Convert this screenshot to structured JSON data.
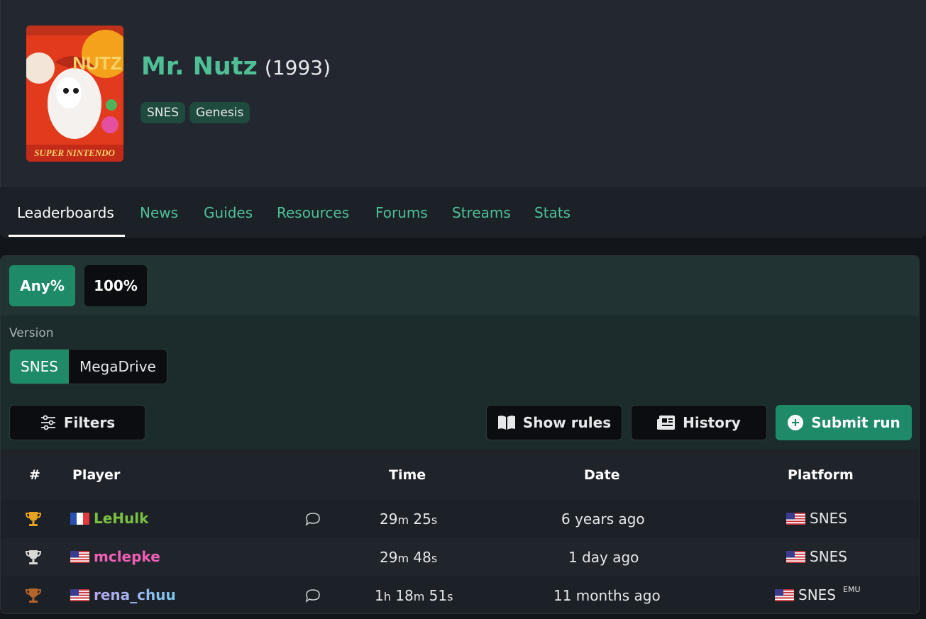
{
  "game": {
    "title": "Mr. Nutz",
    "year": "(1993)",
    "platforms": [
      "SNES",
      "Genesis"
    ]
  },
  "nav": {
    "tabs": [
      "Leaderboards",
      "News",
      "Guides",
      "Resources",
      "Forums",
      "Streams",
      "Stats"
    ],
    "active": "Leaderboards"
  },
  "categories": {
    "items": [
      "Any%",
      "100%"
    ],
    "selected": "Any%"
  },
  "version": {
    "label": "Version",
    "options": [
      "SNES",
      "MegaDrive"
    ],
    "selected": "SNES"
  },
  "actions": {
    "filters": "Filters",
    "show_rules": "Show rules",
    "history": "History",
    "submit": "Submit run"
  },
  "table": {
    "headers": {
      "rank": "#",
      "player": "Player",
      "time": "Time",
      "date": "Date",
      "platform": "Platform"
    },
    "rows": [
      {
        "rank_icon": "gold-trophy-icon",
        "flag": "france-flag-icon",
        "player": "LeHulk",
        "player_color": "#7bc043",
        "has_comment": true,
        "time": {
          "h": "",
          "m": "29",
          "s": "25"
        },
        "date": "6 years ago",
        "platform_flag": "usa-flag-icon",
        "platform": "SNES",
        "emu": ""
      },
      {
        "rank_icon": "silver-trophy-icon",
        "flag": "usa-flag-icon",
        "player": "mclepke",
        "player_color": "#ee5fb5",
        "has_comment": false,
        "time": {
          "h": "",
          "m": "29",
          "s": "48"
        },
        "date": "1 day ago",
        "platform_flag": "usa-flag-icon",
        "platform": "SNES",
        "emu": ""
      },
      {
        "rank_icon": "bronze-trophy-icon",
        "flag": "usa-flag-icon",
        "player": "rena_chuu",
        "player_color": "#8fb8e8",
        "has_comment": true,
        "time": {
          "h": "1",
          "m": "18",
          "s": "51"
        },
        "date": "11 months ago",
        "platform_flag": "usa-flag-icon",
        "platform": "SNES",
        "emu": "EMU"
      }
    ]
  },
  "colors": {
    "accent": "#4fbf97",
    "button_green": "#1e8a67",
    "gold": "#e8a020",
    "silver": "#d8d8d8",
    "bronze": "#b5652c"
  }
}
